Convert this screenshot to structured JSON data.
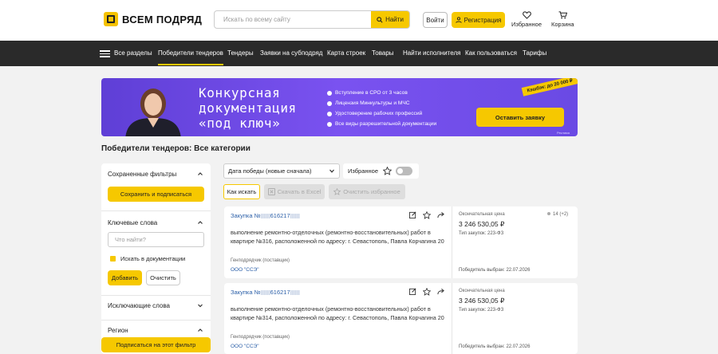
{
  "header": {
    "logo_text": "ВСЕМ ПОДРЯД",
    "search_placeholder": "Искать по всему сайту",
    "search_button": "Найти",
    "login": "Войти",
    "register": "Регистрация",
    "favorites": "Избранное",
    "cart": "Корзина"
  },
  "nav": {
    "all_sections": "Все разделы",
    "items": [
      "Победители тендеров",
      "Тендеры",
      "Заявки на субподряд",
      "Карта строек",
      "Товары",
      "Найти исполнителя",
      "Как пользоваться",
      "Тарифы"
    ]
  },
  "banner": {
    "title_lines": [
      "Конкурсная",
      "документация",
      "«под ключ»"
    ],
    "bullets": [
      "Вступление в СРО от 3 часов",
      "Лицензия Минкультуры и МЧС",
      "Удостоверение рабочих профессий",
      "Все виды разрешительной документации"
    ],
    "cta": "Оставить заявку",
    "tag": "Кэшбэк: до 20 000 ₽",
    "fine_print": "Реклама"
  },
  "page_title": "Победители тендеров: Все категории",
  "sidebar": {
    "saved_filters": "Сохраненные фильтры",
    "save_subscribe": "Сохранить и подписаться",
    "keywords": "Ключевые слова",
    "keywords_placeholder": "Что найти?",
    "search_in_docs": "Искать в документации",
    "add": "Добавить",
    "clear": "Очистить",
    "exclude_words": "Исключающие слова",
    "region": "Регион",
    "subscribe_filter": "Подписаться на этот фильтр"
  },
  "controls": {
    "sort_value": "Дата победы (новые сначала)",
    "favorites_label": "Избранное",
    "favorites_on": false,
    "how_to_search": "Как искать",
    "download_excel": "Скачать в Excel",
    "clear_favorites": "Очистить избранное"
  },
  "cards": [
    {
      "title": "Закупка №",
      "number_visible": "616217",
      "description": "выполнение ремонтно-отделочных (ремонтно-восстановительных) работ в квартире №316, расположенной по адресу: г. Севастополь, Павла Корчагина 20",
      "role": "Генподрядчик (поставщик)",
      "org": "ООО \"ССЭ\"",
      "price_label": "Окончательная цена",
      "price": "3 246 530,05 ₽",
      "law": "Тип закупок: 223-ФЗ",
      "count": "14 (+2)",
      "winner": "Победитель выбран: 22.07.2026"
    },
    {
      "title": "Закупка №",
      "number_visible": "616217",
      "description": "выполнение ремонтно-отделочных (ремонтно-восстановительных) работ в квартире №314, расположенной по адресу: г. Севастополь, Павла Корчагина 20",
      "role": "Генподрядчик (поставщик)",
      "org": "ООО \"ССЭ\"",
      "price_label": "Окончательная цена",
      "price": "3 246 530,05 ₽",
      "law": "Тип закупок: 223-ФЗ",
      "count": "",
      "winner": "Победитель выбран: 22.07.2026"
    }
  ],
  "colors": {
    "accent": "#f6c800",
    "nav_bg": "#2a2a2a",
    "banner": "#6a4ae4",
    "link": "#2b5fa8"
  }
}
